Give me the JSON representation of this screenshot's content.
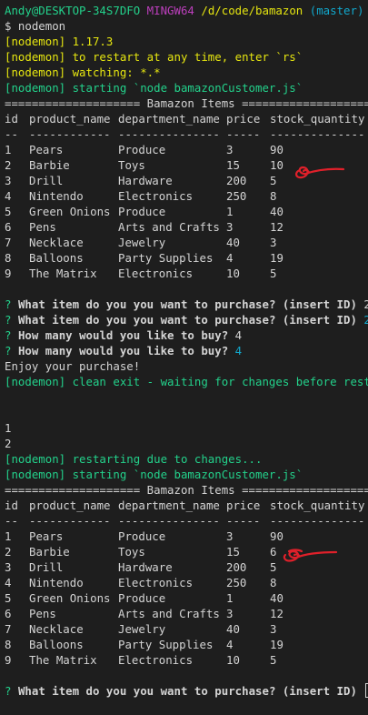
{
  "prompt": {
    "user": "Andy@DESKTOP-34S7DFO",
    "shell": "MINGW64",
    "path": "/d/code/bamazon",
    "branch": "(master)",
    "command": "$ nodemon"
  },
  "nodemon_start": [
    "[nodemon] 1.17.3",
    "[nodemon] to restart at any time, enter `rs`",
    "[nodemon] watching: *.*",
    "[nodemon] starting `node bamazonCustomer.js`"
  ],
  "table1": {
    "banner": "==================== Bamazon Items ====================",
    "headers": [
      "id",
      "product_name",
      "department_name",
      "price",
      "stock_quantity"
    ],
    "dashes": [
      "--",
      "------------",
      "---------------",
      "-----",
      "--------------"
    ],
    "rows": [
      [
        "1",
        "Pears",
        "Produce",
        "3",
        "90"
      ],
      [
        "2",
        "Barbie",
        "Toys",
        "15",
        "10"
      ],
      [
        "3",
        "Drill",
        "Hardware",
        "200",
        "5"
      ],
      [
        "4",
        "Nintendo",
        "Electronics",
        "250",
        "8"
      ],
      [
        "5",
        "Green Onions",
        "Produce",
        "1",
        "40"
      ],
      [
        "6",
        "Pens",
        "Arts and Crafts",
        "3",
        "12"
      ],
      [
        "7",
        "Necklace",
        "Jewelry",
        "40",
        "3"
      ],
      [
        "8",
        "Balloons",
        "Party Supplies",
        "4",
        "19"
      ],
      [
        "9",
        "The Matrix",
        "Electronics",
        "10",
        "5"
      ]
    ]
  },
  "qa": {
    "q_mark": "?",
    "q1": "What item do you you want to purchase? (insert ID)",
    "a1_typed": "2",
    "a1_confirmed": "2",
    "q2": "How many would you like to buy?",
    "a2_typed": "4",
    "a2_confirmed": "4",
    "enjoy": "Enjoy your purchase!",
    "clean_exit": "[nodemon] clean exit - waiting for changes before restart"
  },
  "typed_lines": [
    "1",
    "2"
  ],
  "nodemon_restart": [
    "[nodemon] restarting due to changes...",
    "[nodemon] starting `node bamazonCustomer.js`"
  ],
  "table2": {
    "banner": "==================== Bamazon Items ====================",
    "headers": [
      "id",
      "product_name",
      "department_name",
      "price",
      "stock_quantity"
    ],
    "dashes": [
      "--",
      "------------",
      "---------------",
      "-----",
      "--------------"
    ],
    "rows": [
      [
        "1",
        "Pears",
        "Produce",
        "3",
        "90"
      ],
      [
        "2",
        "Barbie",
        "Toys",
        "15",
        "6"
      ],
      [
        "3",
        "Drill",
        "Hardware",
        "200",
        "5"
      ],
      [
        "4",
        "Nintendo",
        "Electronics",
        "250",
        "8"
      ],
      [
        "5",
        "Green Onions",
        "Produce",
        "1",
        "40"
      ],
      [
        "6",
        "Pens",
        "Arts and Crafts",
        "3",
        "12"
      ],
      [
        "7",
        "Necklace",
        "Jewelry",
        "40",
        "3"
      ],
      [
        "8",
        "Balloons",
        "Party Supplies",
        "4",
        "19"
      ],
      [
        "9",
        "The Matrix",
        "Electronics",
        "10",
        "5"
      ]
    ]
  },
  "final_prompt": "What item do you you want to purchase? (insert ID)",
  "colors": {
    "background": "#1e1e1e",
    "text": "#d4d4d4",
    "green": "#23d18b",
    "magenta": "#bc3fbc",
    "yellow": "#e5e510",
    "cyan": "#11a8cd",
    "annotation_red": "#e0202a"
  }
}
